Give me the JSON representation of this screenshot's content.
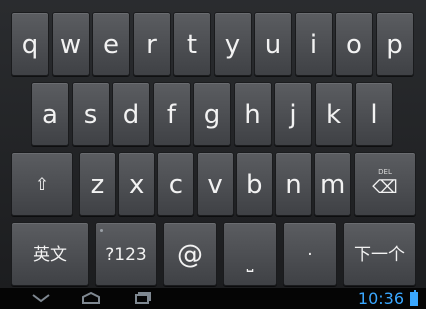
{
  "keyboard": {
    "row1": [
      "q",
      "w",
      "e",
      "r",
      "t",
      "y",
      "u",
      "i",
      "o",
      "p"
    ],
    "row2": [
      "a",
      "s",
      "d",
      "f",
      "g",
      "h",
      "j",
      "k",
      "l"
    ],
    "row3": {
      "shift_icon": "shift-up-icon",
      "letters": [
        "z",
        "x",
        "c",
        "v",
        "b",
        "n",
        "m"
      ],
      "delete_icon": "delete-backspace-icon",
      "delete_label": "DEL"
    },
    "row4": {
      "lang": "英文",
      "num": "?123",
      "at": "@",
      "space": "⎵",
      "dot": "·",
      "next": "下一个"
    }
  },
  "system_bar": {
    "time": "10:36",
    "icons": [
      "back-icon",
      "home-icon",
      "recent-apps-icon",
      "battery-icon"
    ],
    "accent": "#3aa7ff"
  }
}
